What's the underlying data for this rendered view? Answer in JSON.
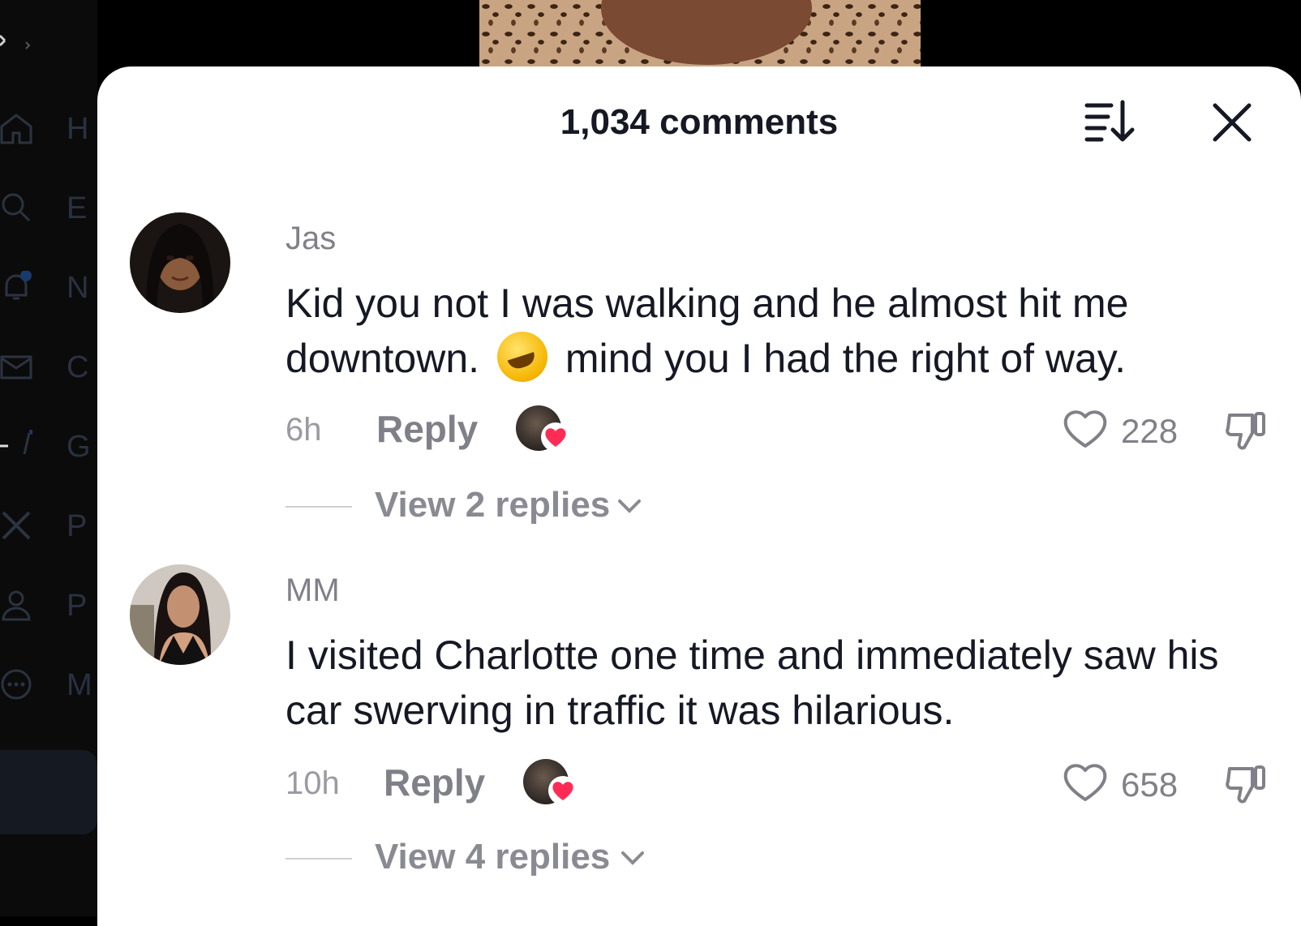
{
  "background_nav": {
    "items": [
      {
        "icon": "home-icon",
        "label": "H"
      },
      {
        "icon": "search-icon",
        "label": "E"
      },
      {
        "icon": "bell-icon",
        "label": "N"
      },
      {
        "icon": "mail-icon",
        "label": "C"
      },
      {
        "icon": "grok-icon",
        "label": "G"
      },
      {
        "icon": "x-logo-icon",
        "label": "P"
      },
      {
        "icon": "profile-icon",
        "label": "P"
      },
      {
        "icon": "more-icon",
        "label": "M"
      }
    ]
  },
  "header": {
    "title": "1,034 comments",
    "sort_icon": "sort-icon",
    "close_icon": "close-icon"
  },
  "comments": [
    {
      "username": "Jas",
      "text_before_emoji": "Kid you not I was walking and he almost hit me downtown.",
      "emoji": "rolling-on-floor-laughing-emoji",
      "text_after_emoji": "mind you I had the right of way.",
      "time": "6h",
      "reply_label": "Reply",
      "likes": "228",
      "view_replies": "View 2 replies"
    },
    {
      "username": "MM",
      "text": "I visited Charlotte one time and immediately saw his car swerving in traffic it was hilarious.",
      "time": "10h",
      "reply_label": "Reply",
      "likes": "658",
      "view_replies": "View 4 replies"
    }
  ],
  "colors": {
    "sheet_bg": "#ffffff",
    "primary_text": "#161823",
    "secondary_text": "#808088",
    "heart_badge": "#fe2c55"
  }
}
